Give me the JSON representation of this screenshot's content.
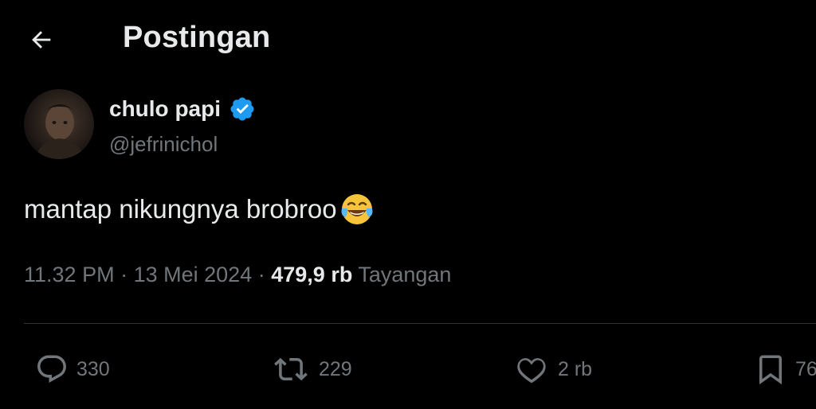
{
  "header": {
    "title": "Postingan",
    "back_icon": "arrow-left-icon"
  },
  "author": {
    "display_name": "chulo papi",
    "handle": "@jefrinichol",
    "verified": true,
    "verified_color": "#1d9bf0"
  },
  "tweet": {
    "text": "mantap nikungnya brobroo",
    "emoji": "😂"
  },
  "meta": {
    "time": "11.32 PM",
    "separator": "·",
    "date": "13 Mei 2024",
    "views_count": "479,9 rb",
    "views_label": "Tayangan"
  },
  "actions": {
    "replies": "330",
    "reposts": "229",
    "likes": "2 rb",
    "bookmarks": "76"
  },
  "colors": {
    "background": "#000000",
    "primary_text": "#e7e9ea",
    "secondary_text": "#71767b",
    "divider": "#2f3336"
  }
}
